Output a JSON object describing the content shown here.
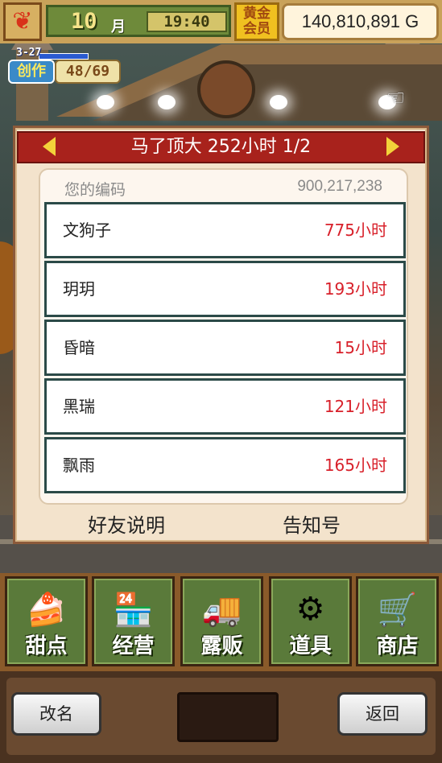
{
  "hud": {
    "leaf_icon": "maple-leaf-icon",
    "month": "10",
    "month_label": "月",
    "time": "19:40",
    "gold_member": "黄金会员",
    "money": "140,810,891 G"
  },
  "create": {
    "small": "3-27",
    "label": "创作",
    "value": "48/69"
  },
  "dialog": {
    "title": "马了顶大  252小时 1/2",
    "code_label": "您的编码",
    "code_value": "900,217,238",
    "rows": [
      {
        "name": "文狗子",
        "hours": "775小时"
      },
      {
        "name": "玥玥",
        "hours": "193小时"
      },
      {
        "name": "昏暗",
        "hours": "15小时"
      },
      {
        "name": "黑瑞",
        "hours": "121小时"
      },
      {
        "name": "飘雨",
        "hours": "165小时"
      }
    ],
    "friend_help": "好友说明",
    "notice": "告知号"
  },
  "menu": [
    {
      "label": "甜点",
      "icon": "cake-icon"
    },
    {
      "label": "经营",
      "icon": "shop-building-icon"
    },
    {
      "label": "露贩",
      "icon": "food-truck-icon"
    },
    {
      "label": "道具",
      "icon": "tool-bag-icon"
    },
    {
      "label": "商店",
      "icon": "shopping-cart-icon"
    }
  ],
  "bottom": {
    "rename": "改名",
    "back": "返回"
  },
  "colors": {
    "title_bar": "#a8221c",
    "hours_text": "#d8202a",
    "menu_green": "#5a7a3a"
  }
}
